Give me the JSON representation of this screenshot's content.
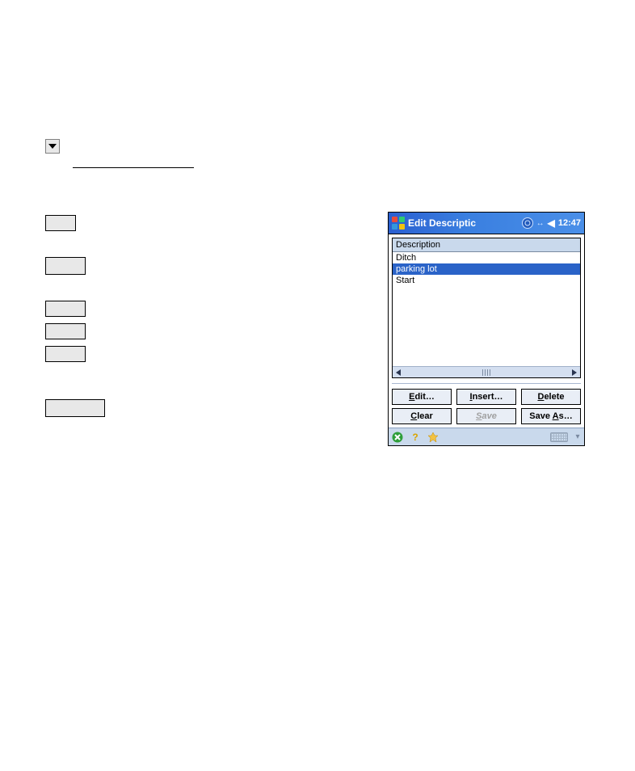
{
  "titlebar": {
    "title": "Edit Descriptic",
    "clock": "12:47"
  },
  "list": {
    "header": "Description",
    "items": [
      "Ditch",
      "parking lot",
      "Start"
    ],
    "selected_index": 1
  },
  "buttons": {
    "edit": "Edit…",
    "insert": "Insert…",
    "delete": "Delete",
    "clear": "Clear",
    "save": "Save",
    "saveas": "Save As…"
  },
  "buttons_accel": {
    "edit": "E",
    "insert": "I",
    "delete": "D",
    "clear": "C",
    "save": "S",
    "saveas": "A"
  }
}
